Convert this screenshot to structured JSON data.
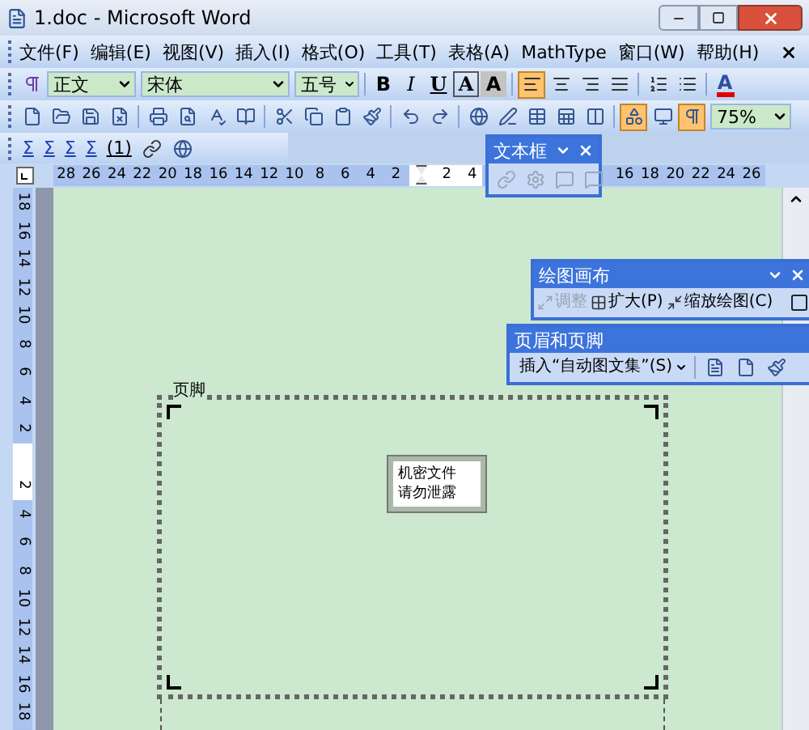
{
  "window": {
    "title": "1.doc - Microsoft Word"
  },
  "menu": [
    {
      "label": "文件(F)"
    },
    {
      "label": "编辑(E)"
    },
    {
      "label": "视图(V)"
    },
    {
      "label": "插入(I)"
    },
    {
      "label": "格式(O)"
    },
    {
      "label": "工具(T)"
    },
    {
      "label": "表格(A)"
    },
    {
      "label": "MathType"
    },
    {
      "label": "窗口(W)"
    },
    {
      "label": "帮助(H)"
    }
  ],
  "formatting_toolbar": {
    "style": "正文",
    "font": "宋体",
    "size": "五号",
    "text_buttons": [
      "B",
      "I",
      "U",
      "A",
      "A"
    ],
    "alignment": [
      {
        "selected": true
      },
      {
        "selected": false
      },
      {
        "selected": false
      },
      {
        "selected": false
      }
    ],
    "font_color": "A"
  },
  "standard_toolbar": {
    "buttons": [
      {
        "kind": "new",
        "pressed": false
      },
      {
        "kind": "open",
        "pressed": false
      },
      {
        "kind": "save",
        "pressed": false
      },
      {
        "kind": "permission",
        "pressed": false
      },
      {
        "kind": "print",
        "pressed": false
      },
      {
        "kind": "preview",
        "pressed": false
      },
      {
        "kind": "spelling",
        "pressed": false
      },
      {
        "kind": "research",
        "pressed": false
      },
      {
        "kind": "cut",
        "pressed": false
      },
      {
        "kind": "copy",
        "pressed": false
      },
      {
        "kind": "paste",
        "pressed": false
      },
      {
        "kind": "format_painter",
        "pressed": false
      },
      {
        "kind": "undo",
        "pressed": false
      },
      {
        "kind": "redo",
        "pressed": false
      },
      {
        "kind": "hyperlink",
        "pressed": false
      },
      {
        "kind": "tables_borders",
        "pressed": false
      },
      {
        "kind": "table",
        "pressed": false
      },
      {
        "kind": "spreadsheet",
        "pressed": false
      },
      {
        "kind": "columns",
        "pressed": false
      },
      {
        "kind": "drawing",
        "pressed": true
      },
      {
        "kind": "document_map",
        "pressed": false
      },
      {
        "kind": "show_hide",
        "pressed": true
      }
    ],
    "zoom": "75%"
  },
  "mathtype_toolbar": {
    "buttons": [
      "Σ",
      "Σ",
      "Σ",
      "Σ",
      "(1)"
    ]
  },
  "ruler": {
    "left_numbers": [
      "28",
      "26",
      "24",
      "22",
      "20",
      "18",
      "16",
      "14",
      "12",
      "10",
      "8",
      "6",
      "4",
      "2"
    ],
    "right_numbers": [
      "2",
      "4"
    ],
    "far_numbers": [
      "16",
      "18",
      "20",
      "22",
      "24",
      "26"
    ]
  },
  "vertical_ruler": {
    "top_numbers": [
      "18",
      "16",
      "14",
      "12",
      "10",
      "8",
      "6",
      "4",
      "2"
    ],
    "bottom_numbers": [
      "2",
      "4",
      "6",
      "8",
      "10",
      "12",
      "14",
      "16",
      "18"
    ]
  },
  "footer": {
    "label": "页脚",
    "text_box": [
      "机密文件",
      "请勿泄露"
    ]
  },
  "floating_toolbars": [
    {
      "kind": "textbox",
      "title": "文本框"
    },
    {
      "kind": "canvas",
      "title": "绘图画布",
      "buttons": [
        {
          "label": "调整",
          "disabled": true
        },
        {
          "label": "扩大(P)",
          "disabled": false
        },
        {
          "label": "缩放绘图(C)",
          "disabled": false
        }
      ]
    },
    {
      "kind": "header_footer",
      "title": "页眉和页脚",
      "insert": "插入“自动图文集”(S)"
    }
  ]
}
